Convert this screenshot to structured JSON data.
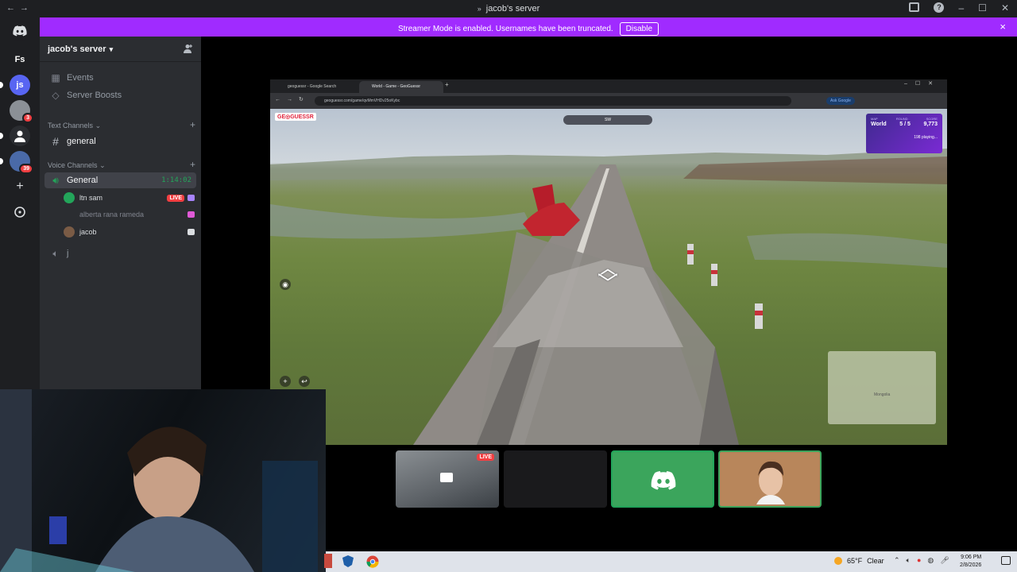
{
  "window": {
    "title": "jacob's server",
    "title_prefix": "»"
  },
  "banner": {
    "message": "Streamer Mode is enabled. Usernames have been truncated.",
    "disable_label": "Disable",
    "close_icon": "×"
  },
  "rail": {
    "home_icon": "discord-logo",
    "servers": [
      {
        "label": "Fs",
        "color": "#1e1f22"
      },
      {
        "label": "js",
        "color": "#5865f2",
        "badge": ""
      },
      {
        "label": "",
        "color": "#8b9096",
        "badge": "3"
      },
      {
        "label": "",
        "color": "#2b2d31"
      },
      {
        "label": "",
        "color": "#4a6aa8",
        "badge": "39"
      }
    ]
  },
  "server": {
    "name": "jacob's server"
  },
  "menu": {
    "events": "Events",
    "boosts": "Server Boosts"
  },
  "text_category": "Text Channels",
  "text_channels": [
    {
      "name": "general"
    }
  ],
  "voice_category": "Voice Channels",
  "voice_channel": {
    "name": "General",
    "timer": "1:14:02"
  },
  "voice_users": [
    {
      "name": "ltn sam",
      "live": "LIVE",
      "avatar_color": "#23a55a"
    },
    {
      "name": "alberta rana rameda",
      "avatar_color": "transparent"
    },
    {
      "name": "jacob",
      "avatar_color": "#7a5b45"
    }
  ],
  "locked_channel": {
    "name": "j"
  },
  "browser": {
    "tabs": [
      "geoguessr - Google Search",
      "World - Game - GeoGuessr"
    ],
    "url": "geoguessr.com/game/qvMmVHDv25oKybc",
    "ask_google": "Ask Google"
  },
  "game": {
    "logo": "GE◎GUESSR",
    "compass": "SW",
    "score_headers": [
      "MAP",
      "ROUND",
      "SCORE"
    ],
    "map": "World",
    "round": "5 / 5",
    "score": "9,773",
    "playing": "198 playing...",
    "minimap_label": "Mongolia"
  },
  "tiles": {
    "live": "LIVE"
  },
  "taskbar": {
    "temperature": "65°F",
    "weather": "Clear",
    "time": "9:06 PM",
    "date": "2/8/2026"
  }
}
